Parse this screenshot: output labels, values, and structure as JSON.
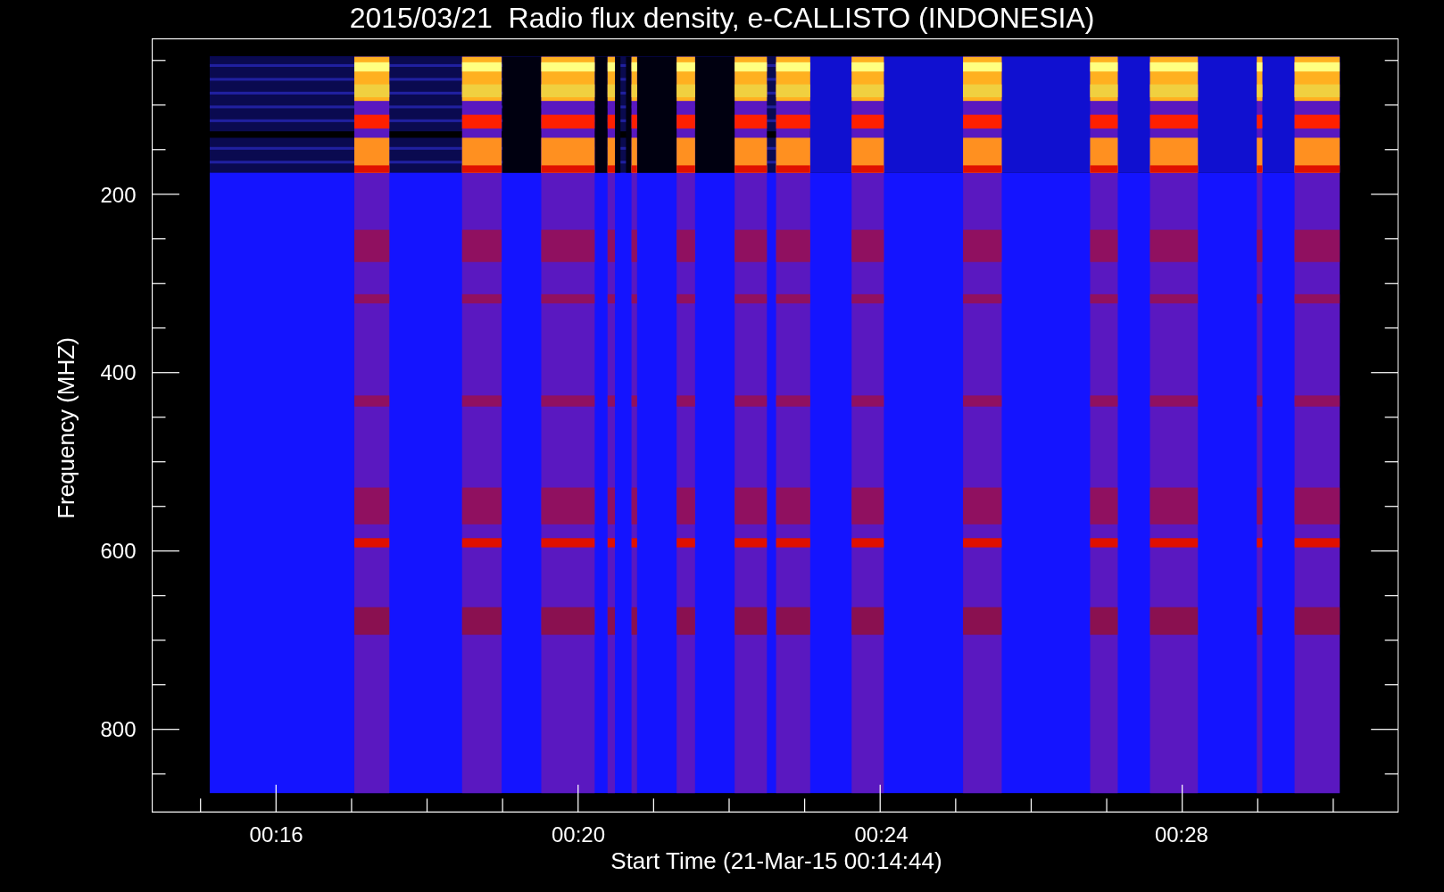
{
  "title": "2015/03/21  Radio flux density, e-CALLISTO (INDONESIA)",
  "y_axis": {
    "label": "Frequency (MHZ)",
    "ticks": [
      "200",
      "400",
      "600",
      "800"
    ]
  },
  "x_axis": {
    "label": "Start Time (21-Mar-15 00:14:44)",
    "ticks": [
      "00:16",
      "00:20",
      "00:24",
      "00:28"
    ]
  }
}
